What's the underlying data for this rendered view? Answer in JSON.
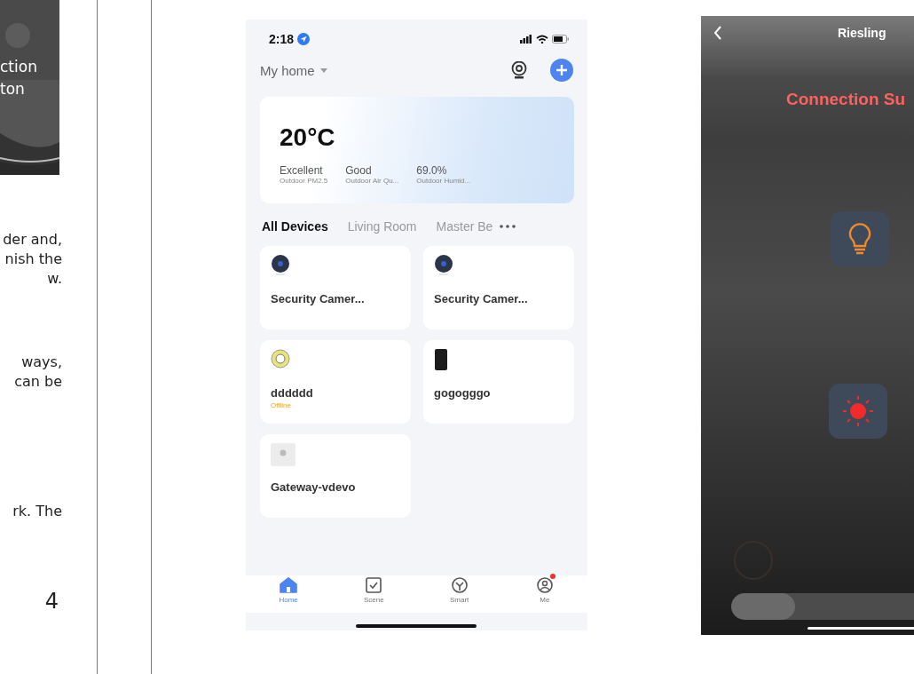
{
  "manual": {
    "photo_caption": [
      "ction",
      "ton"
    ],
    "paragraphs": [
      [
        "der and,",
        "nish the",
        "w."
      ],
      [
        "ways,",
        " can be"
      ],
      [
        "rk. The"
      ]
    ],
    "page_number": "4"
  },
  "home_app": {
    "status_bar": {
      "time": "2:18"
    },
    "home_selector": "My home",
    "weather": {
      "temperature": "20°C",
      "stats": [
        {
          "value": "Excellent",
          "label": "Outdoor PM2.5"
        },
        {
          "value": "Good",
          "label": "Outdoor Air Qu..."
        },
        {
          "value": "69.0%",
          "label": "Outdoor Humid..."
        }
      ]
    },
    "room_tabs": [
      {
        "label": "All Devices",
        "selected": true
      },
      {
        "label": "Living Room",
        "selected": false
      },
      {
        "label": "Master Be",
        "selected": false
      }
    ],
    "devices": [
      {
        "name": "Security Camer...",
        "kind": "camera"
      },
      {
        "name": "Security Camer...",
        "kind": "camera"
      },
      {
        "name": "dddddd",
        "kind": "sensor",
        "status": "Offline"
      },
      {
        "name": "gogogggo",
        "kind": "doorbell"
      },
      {
        "name": "Gateway-vdevo",
        "kind": "gateway"
      }
    ],
    "nav": [
      {
        "label": "Home",
        "kind": "home",
        "selected": true,
        "badge": false
      },
      {
        "label": "Scene",
        "kind": "scene",
        "selected": false,
        "badge": false
      },
      {
        "label": "Smart",
        "kind": "smart",
        "selected": false,
        "badge": false
      },
      {
        "label": "Me",
        "kind": "me",
        "selected": false,
        "badge": true
      }
    ]
  },
  "light_app": {
    "title": "Riesling",
    "message": "Connection Su",
    "controls": [
      {
        "kind": "bulb"
      },
      {
        "kind": "sun"
      }
    ],
    "slider": {
      "level": 0.3
    }
  }
}
